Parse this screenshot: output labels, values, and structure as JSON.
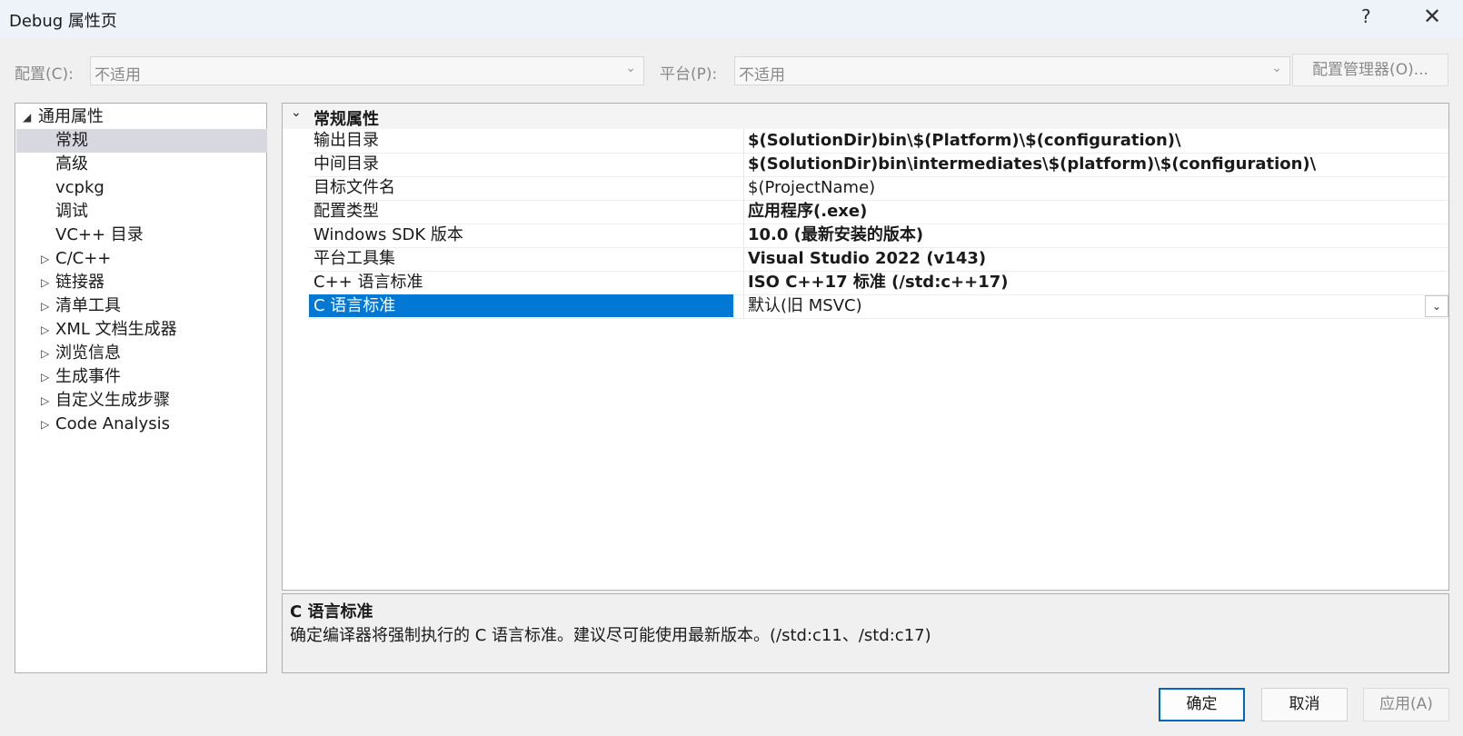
{
  "window": {
    "title": "Debug 属性页",
    "help_glyph": "?",
    "close_glyph": "✕"
  },
  "toolbar": {
    "config_label": "配置(C):",
    "config_value": "不适用",
    "platform_label": "平台(P):",
    "platform_value": "不适用",
    "config_manager_label": "配置管理器(O)..."
  },
  "tree": {
    "root": "通用属性",
    "items": [
      {
        "label": "常规",
        "selected": true,
        "expandable": false
      },
      {
        "label": "高级",
        "expandable": false
      },
      {
        "label": "vcpkg",
        "expandable": false
      },
      {
        "label": "调试",
        "expandable": false
      },
      {
        "label": "VC++ 目录",
        "expandable": false
      },
      {
        "label": "C/C++",
        "expandable": true
      },
      {
        "label": "链接器",
        "expandable": true
      },
      {
        "label": "清单工具",
        "expandable": true
      },
      {
        "label": "XML 文档生成器",
        "expandable": true
      },
      {
        "label": "浏览信息",
        "expandable": true
      },
      {
        "label": "生成事件",
        "expandable": true
      },
      {
        "label": "自定义生成步骤",
        "expandable": true
      },
      {
        "label": "Code Analysis",
        "expandable": true
      }
    ]
  },
  "grid": {
    "category": "常规属性",
    "rows": [
      {
        "name": "输出目录",
        "value": "$(SolutionDir)bin\\$(Platform)\\$(configuration)\\",
        "bold": true
      },
      {
        "name": "中间目录",
        "value": "$(SolutionDir)bin\\intermediates\\$(platform)\\$(configuration)\\",
        "bold": true
      },
      {
        "name": "目标文件名",
        "value": "$(ProjectName)",
        "bold": false
      },
      {
        "name": "配置类型",
        "value": "应用程序(.exe)",
        "bold": true
      },
      {
        "name": "Windows SDK 版本",
        "value": "10.0 (最新安装的版本)",
        "bold": true
      },
      {
        "name": "平台工具集",
        "value": "Visual Studio 2022 (v143)",
        "bold": true
      },
      {
        "name": "C++ 语言标准",
        "value": "ISO C++17 标准 (/std:c++17)",
        "bold": true
      },
      {
        "name": "C 语言标准",
        "value": "默认(旧 MSVC)",
        "bold": false,
        "selected": true
      }
    ]
  },
  "description": {
    "title": "C 语言标准",
    "text": "确定编译器将强制执行的 C 语言标准。建议尽可能使用最新版本。(/std:c11、/std:c17)"
  },
  "buttons": {
    "ok": "确定",
    "cancel": "取消",
    "apply": "应用(A)"
  },
  "colors": {
    "selection_accent": "#0078d4",
    "primary_border": "#0067c0"
  }
}
